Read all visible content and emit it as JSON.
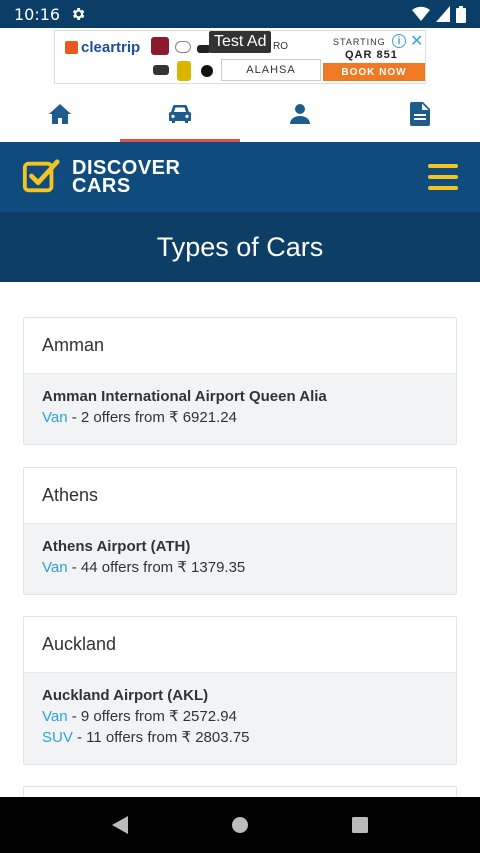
{
  "status": {
    "time": "10:16"
  },
  "ad": {
    "brand": "cleartrip",
    "badge": "Test Ad",
    "partial_text": "RO",
    "city": "ALAHSA",
    "starting": "STARTING",
    "price": "QAR 851",
    "cta": "BOOK NOW",
    "info": "i",
    "close": "✕"
  },
  "tabs": [
    {
      "icon": "home-icon"
    },
    {
      "icon": "car-icon",
      "active": true
    },
    {
      "icon": "person-icon"
    },
    {
      "icon": "document-icon"
    }
  ],
  "header": {
    "logo_line1": "DISCOVER",
    "logo_line2": "CARS"
  },
  "page": {
    "title": "Types of Cars"
  },
  "cities": [
    {
      "name": "Amman",
      "airport": "Amman International Airport Queen Alia",
      "offers": [
        {
          "type": "Van",
          "text": " - 2 offers from ₹ 6921.24"
        }
      ]
    },
    {
      "name": "Athens",
      "airport": "Athens Airport (ATH)",
      "offers": [
        {
          "type": "Van",
          "text": " - 44 offers from ₹ 1379.35"
        }
      ]
    },
    {
      "name": "Auckland",
      "airport": "Auckland Airport (AKL)",
      "offers": [
        {
          "type": "Van",
          "text": " - 9 offers from ₹ 2572.94"
        },
        {
          "type": "SUV",
          "text": " - 11 offers from ₹ 2803.75"
        }
      ]
    }
  ],
  "colors": {
    "header": "#0f4c7d",
    "title_band": "#0c3e66",
    "accent_yellow": "#f2c524",
    "link_blue": "#2ba2d8",
    "tab_active": "#e4514a"
  }
}
